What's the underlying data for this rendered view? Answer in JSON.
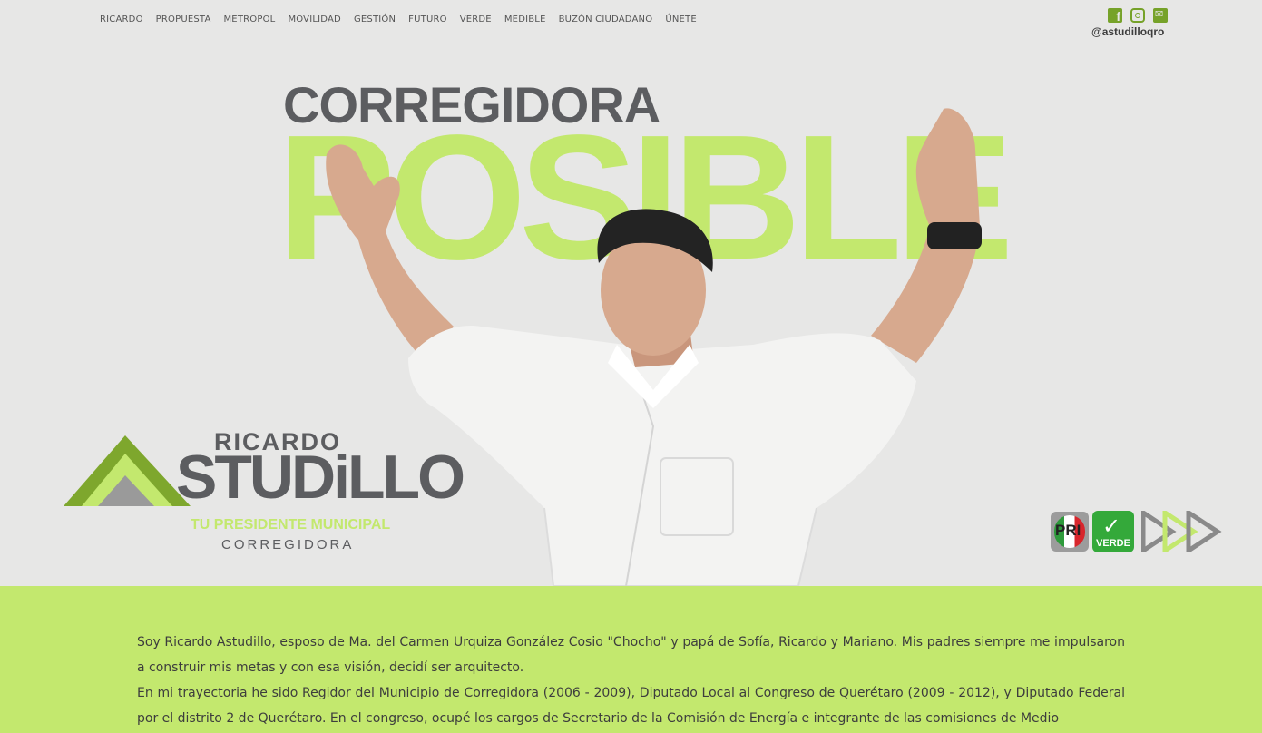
{
  "nav": {
    "items": [
      "RICARDO",
      "PROPUESTA",
      "METROPOL",
      "MOVILIDAD",
      "GESTIÓN",
      "FUTURO",
      "VERDE",
      "MEDIBLE",
      "BUZÓN CIUDADANO",
      "ÚNETE"
    ]
  },
  "social": {
    "icons": [
      "facebook-icon",
      "instagram-icon",
      "twitter-icon"
    ],
    "handle": "@astudilloqro"
  },
  "hero": {
    "title_top": "CORREGIDORA",
    "title_big": "POSIBLE"
  },
  "logo": {
    "first_name": "RICARDO",
    "last_name": "STUDiLLO",
    "tagline": "TU PRESIDENTE MUNICIPAL",
    "city": "CORREGIDORA"
  },
  "parties": {
    "pri": "PRI",
    "verde": "VERDE"
  },
  "bio": {
    "paragraph_1": "Soy Ricardo Astudillo, esposo de Ma. del Carmen Urquiza González Cosio \"Chocho\" y papá de Sofía, Ricardo y Mariano. Mis padres siempre me impulsaron a construir mis metas y con esa visión, decidí ser arquitecto.",
    "paragraph_2": "En mi trayectoria he sido Regidor del Municipio de Corregidora (2006 - 2009), Diputado Local al Congreso de Querétaro (2009 - 2012), y Diputado Federal por el distrito 2 de Querétaro. En el congreso, ocupé los cargos de Secretario de la Comisión de Energía e integrante de las comisiones de Medio"
  },
  "colors": {
    "accent_green": "#c3e86e",
    "dark_gray": "#5c5d60",
    "icon_green": "#76a229",
    "background": "#e7e7e6"
  }
}
